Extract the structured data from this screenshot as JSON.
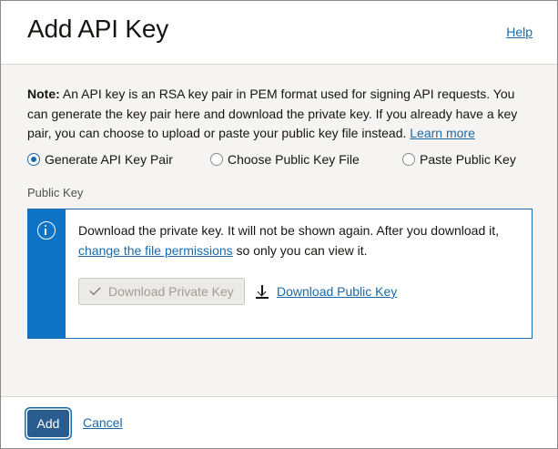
{
  "dialog": {
    "title": "Add API Key",
    "help_label": "Help"
  },
  "note": {
    "label": "Note:",
    "text": " An API key is an RSA key pair in PEM format used for signing API requests. You can generate the key pair here and download the private key. If you already have a key pair, you can choose to upload or paste your public key file instead. ",
    "link": "Learn more"
  },
  "options": [
    {
      "label": "Generate API Key Pair",
      "selected": true
    },
    {
      "label": "Choose Public Key File",
      "selected": false
    },
    {
      "label": "Paste Public Key",
      "selected": false
    }
  ],
  "public_key": {
    "section_label": "Public Key",
    "info_text_1": "Download the private key. It will not be shown again. After you download it, ",
    "info_link": "change the file permissions",
    "info_text_2": " so only you can view it.",
    "download_private_label": "Download Private Key",
    "download_public_label": "Download Public Key"
  },
  "footer": {
    "add_label": "Add",
    "cancel_label": "Cancel"
  },
  "colors": {
    "accent": "#1a6aa8",
    "info_bar": "#0f73c6",
    "primary_button": "#2a5c8f"
  },
  "icons": [
    "info-icon",
    "check-icon",
    "download-icon"
  ]
}
